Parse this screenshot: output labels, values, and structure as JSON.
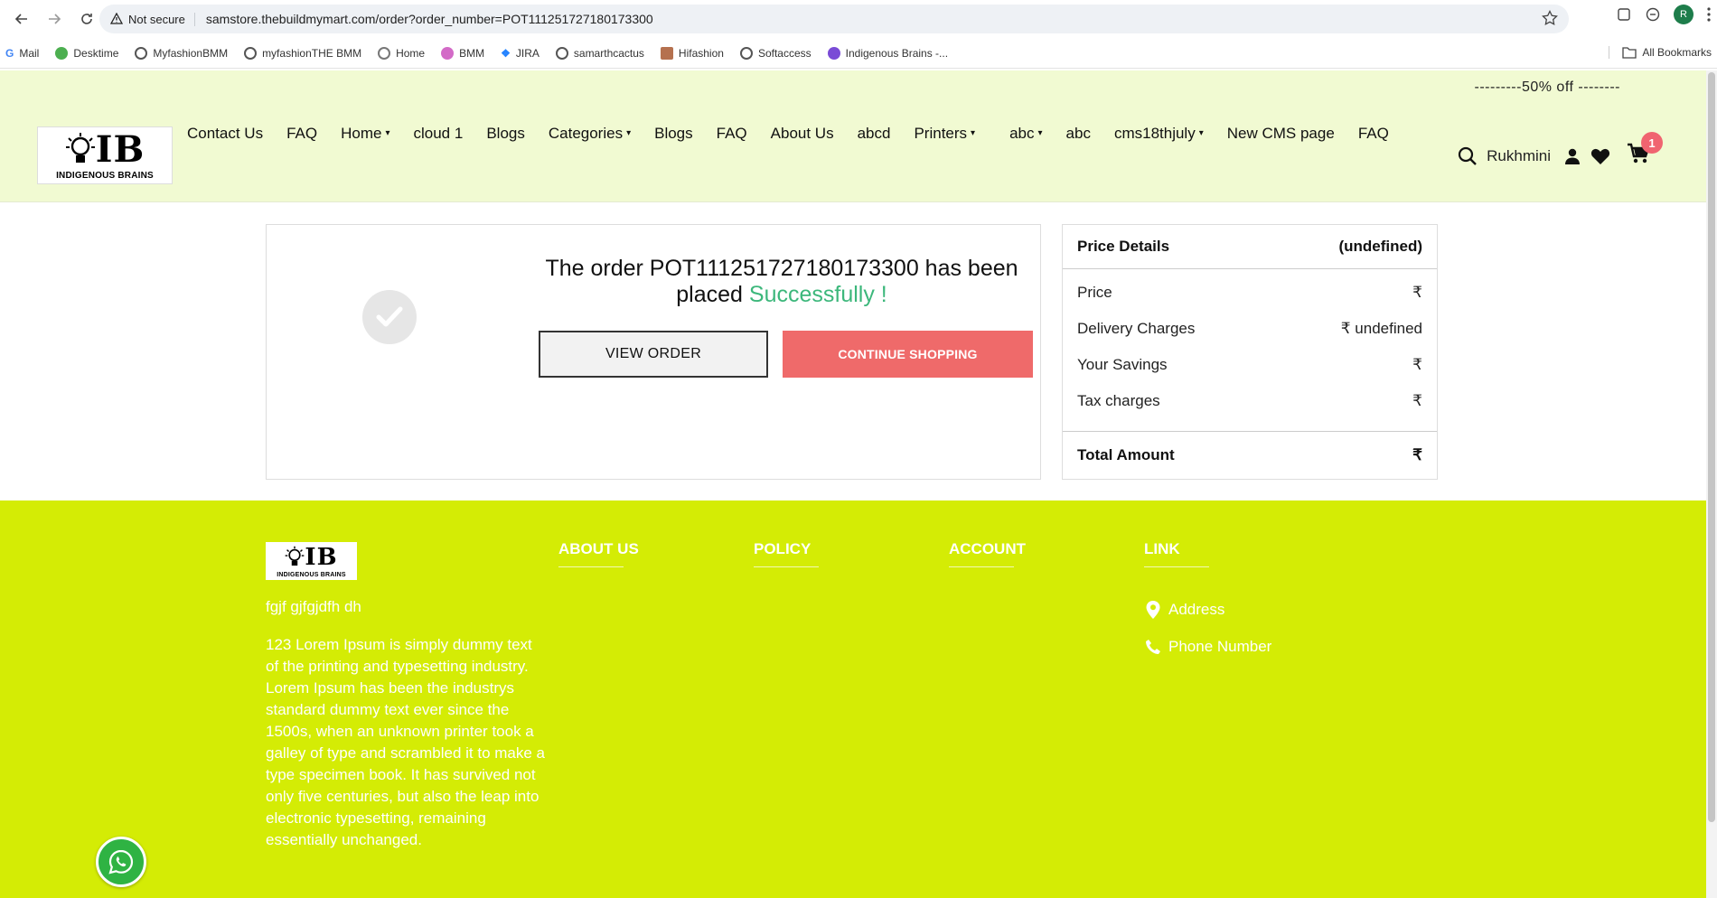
{
  "browser": {
    "security_label": "Not secure",
    "url": "samstore.thebuildmymart.com/order?order_number=POT111251727180173300",
    "profile_initial": "R",
    "bookmarks": [
      "Mail",
      "Desktime",
      "MyfashionBMM",
      "myfashionTHE BMM",
      "Home",
      "BMM",
      "JIRA",
      "samarthcactus",
      "Hifashion",
      "Softaccess",
      "Indigenous Brains -..."
    ],
    "all_bookmarks": "All Bookmarks"
  },
  "header": {
    "promo": "---------50% off --------",
    "logo_mark": "IB",
    "logo_tag": "INDIGENOUS BRAINS",
    "menu": [
      {
        "label": "Contact Us",
        "caret": ""
      },
      {
        "label": "FAQ",
        "caret": ""
      },
      {
        "label": "Home",
        "caret": "▾"
      },
      {
        "label": "cloud 1",
        "caret": ""
      },
      {
        "label": "Blogs",
        "caret": ""
      },
      {
        "label": "Categories",
        "caret": "▾"
      },
      {
        "label": "Blogs",
        "caret": ""
      },
      {
        "label": "FAQ",
        "caret": ""
      },
      {
        "label": "About Us",
        "caret": ""
      },
      {
        "label": "abcd",
        "caret": ""
      },
      {
        "label": "Printers",
        "caret": "▾"
      },
      {
        "label": "abc",
        "caret": "▾"
      },
      {
        "label": "abc",
        "caret": ""
      },
      {
        "label": "cms18thjuly",
        "caret": "▾"
      },
      {
        "label": "New CMS page",
        "caret": ""
      },
      {
        "label": "FAQ",
        "caret": ""
      }
    ],
    "user_name": "Rukhmini",
    "cart_count": "1"
  },
  "order": {
    "message_prefix": "The order POT111251727180173300 has been placed",
    "message_success": "Successfully !",
    "view_order_label": "VIEW ORDER",
    "continue_label": "CONTINUE SHOPPING"
  },
  "price": {
    "title": "Price Details",
    "title_value": "(undefined)",
    "rows": [
      {
        "label": "Price",
        "value": "₹"
      },
      {
        "label": "Delivery Charges",
        "value": "₹ undefined"
      },
      {
        "label": "Your Savings",
        "value": "₹"
      },
      {
        "label": "Tax charges",
        "value": "₹"
      }
    ],
    "total_label": "Total Amount",
    "total_value": "₹"
  },
  "footer": {
    "logo_mark": "IB",
    "logo_tag": "INDIGENOUS BRAINS",
    "tagline": "fgjf gjfgjdfh dh",
    "about_text": "123 Lorem Ipsum is simply dummy text of the printing and typesetting industry. Lorem Ipsum has been the industrys standard dummy text ever since the 1500s, when an unknown printer took a galley of type and scrambled it to make a type specimen book. It has survived not only five centuries, but also the leap into electronic typesetting, remaining essentially unchanged.",
    "headings": {
      "about": "ABOUT US",
      "policy": "POLICY",
      "account": "ACCOUNT",
      "link": "LINK"
    },
    "address_label": "Address",
    "phone_label": "Phone Number"
  },
  "colors": {
    "header_bg": "#f1fad2",
    "footer_bg": "#d4ec05",
    "accent_red": "#ef6a6a",
    "success_green": "#3cb77b"
  }
}
